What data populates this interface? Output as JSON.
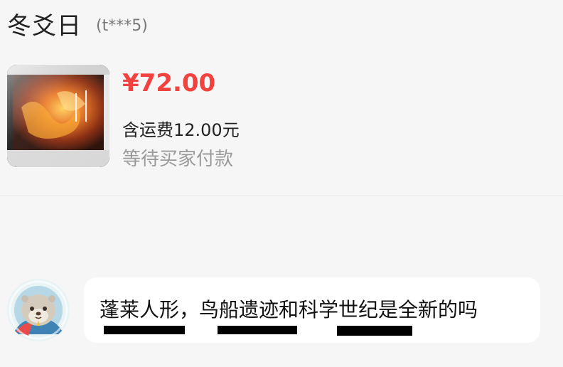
{
  "header": {
    "nickname": "冬爻日",
    "account": "(t***5)"
  },
  "order": {
    "thumbnail_icon": "album-cover-image",
    "price": "¥72.00",
    "shipping": "含运费12.00元",
    "status": "等待买家付款"
  },
  "chat": {
    "avatar_icon": "otter-astronaut-avatar",
    "message": "蓬莱人形，鸟船遗迹和科学世纪是全新的吗"
  },
  "colors": {
    "price": "#f2423f",
    "status": "#9a9a9a",
    "background": "#f6f6f6",
    "bubble": "#ffffff"
  }
}
